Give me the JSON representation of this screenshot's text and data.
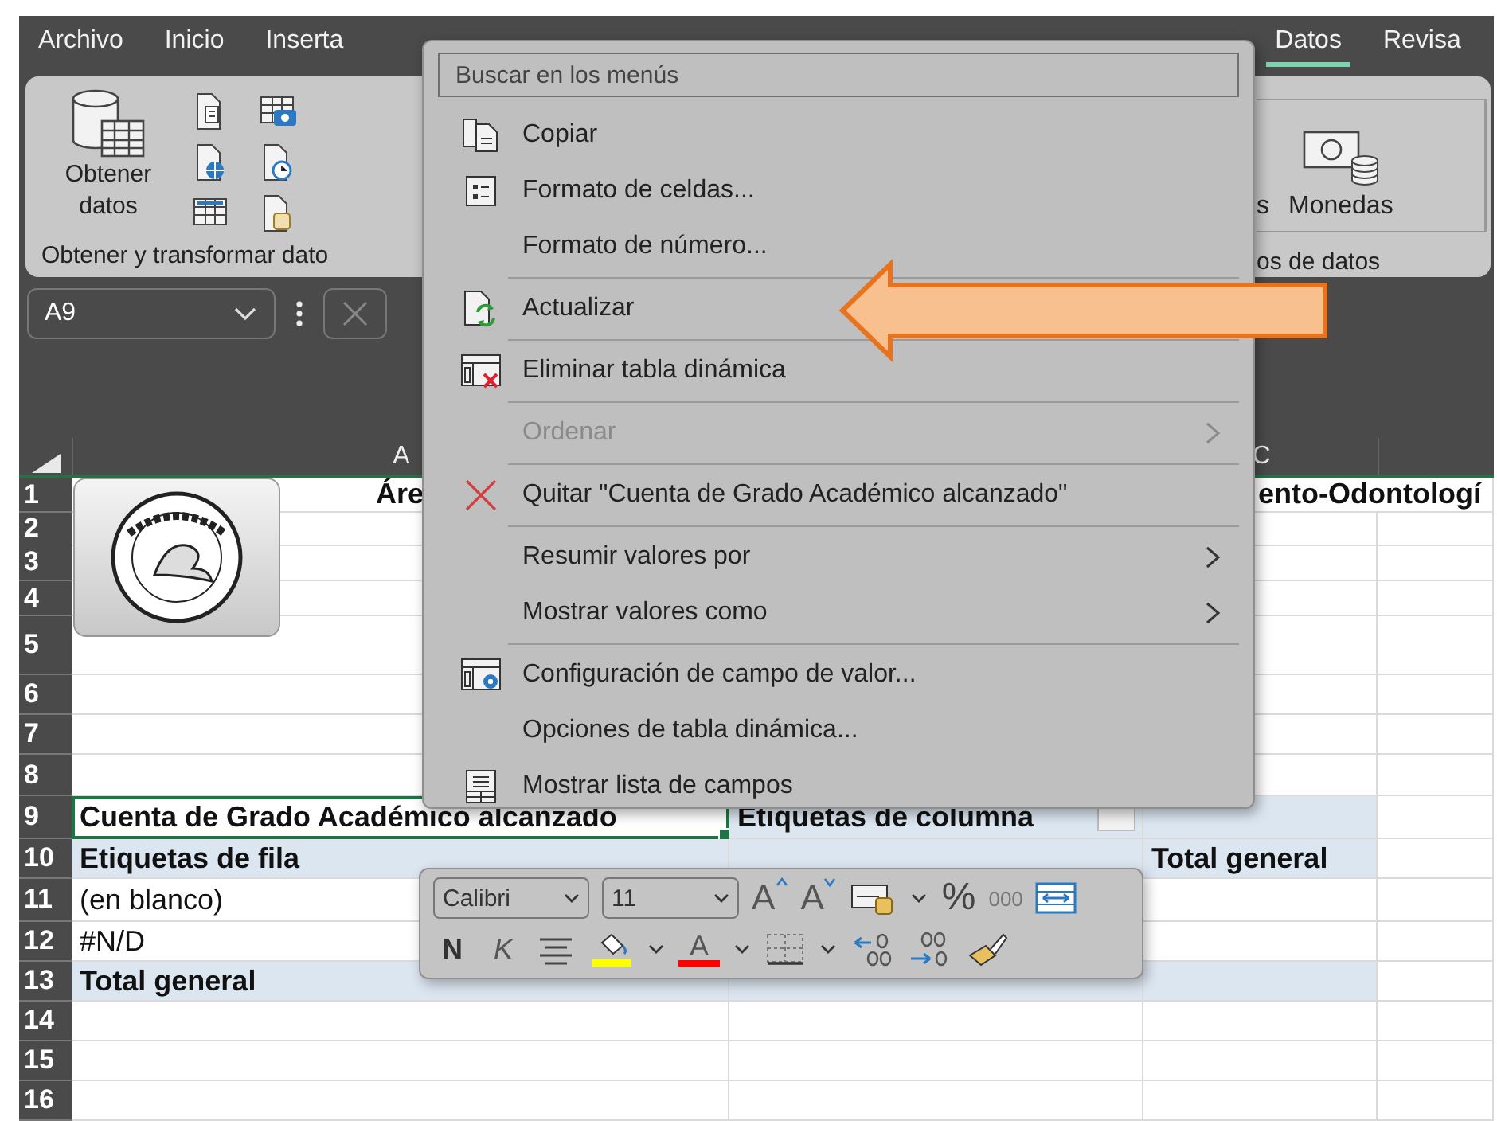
{
  "tabs": [
    {
      "label": "Archivo",
      "selected": false
    },
    {
      "label": "Inicio",
      "selected": false
    },
    {
      "label": "Inserta",
      "selected": false
    },
    {
      "label": "Datos",
      "selected": true
    },
    {
      "label": "Revisa",
      "selected": false
    }
  ],
  "ribbon": {
    "get_data_button": "Obtener datos",
    "left_group_label": "Obtener y transformar dato",
    "partial_button_label": "s",
    "currency_button": "Monedas",
    "right_group_label": "os de datos"
  },
  "formula_bar": {
    "name_box": "A9"
  },
  "sheet": {
    "column_headers": {
      "a": "A",
      "c": "C"
    },
    "rows": [
      {
        "number": "1",
        "kind": "title",
        "cells": {
          "a": {
            "text": "Áre",
            "selected": false
          },
          "c": {
            "text": "ento-Odontologí",
            "selected": false
          }
        }
      },
      {
        "number": "2",
        "kind": "plain",
        "cells": {}
      },
      {
        "number": "3",
        "kind": "plain",
        "cells": {}
      },
      {
        "number": "4",
        "kind": "plain",
        "cells": {}
      },
      {
        "number": "5",
        "kind": "plain",
        "cells": {}
      },
      {
        "number": "6",
        "kind": "plain",
        "cells": {}
      },
      {
        "number": "7",
        "kind": "plain",
        "cells": {}
      },
      {
        "number": "8",
        "kind": "plain",
        "cells": {}
      },
      {
        "number": "9",
        "kind": "band",
        "cells": {
          "a": {
            "text": "Cuenta de Grado Académico alcanzado",
            "selected": true
          },
          "b": {
            "text": "Etiquetas de columna",
            "selected": false
          }
        }
      },
      {
        "number": "10",
        "kind": "band",
        "cells": {
          "a": {
            "text": "Etiquetas de fila",
            "selected": false
          },
          "c": {
            "text": "Total general",
            "selected": false
          }
        }
      },
      {
        "number": "11",
        "kind": "plain",
        "cells": {
          "a": {
            "text": "(en blanco)",
            "selected": false
          }
        }
      },
      {
        "number": "12",
        "kind": "plain",
        "cells": {
          "a": {
            "text": "#N/D",
            "selected": false
          }
        }
      },
      {
        "number": "13",
        "kind": "band",
        "cells": {
          "a": {
            "text": "Total general",
            "selected": false
          }
        }
      },
      {
        "number": "14",
        "kind": "plain",
        "cells": {}
      },
      {
        "number": "15",
        "kind": "plain",
        "cells": {}
      },
      {
        "number": "16",
        "kind": "plain",
        "cells": {}
      }
    ]
  },
  "context_menu": {
    "search_placeholder": "Buscar en los menús",
    "items": [
      {
        "label": "Copiar",
        "kind": "copy",
        "disabled": false,
        "submenu": false,
        "divider_before": false
      },
      {
        "label": "Formato de celdas...",
        "kind": "format",
        "disabled": false,
        "submenu": false,
        "divider_before": false
      },
      {
        "label": "Formato de número...",
        "kind": "plain",
        "disabled": false,
        "submenu": false,
        "divider_before": false
      },
      {
        "label": "Actualizar",
        "kind": "refresh",
        "disabled": false,
        "submenu": false,
        "divider_before": true
      },
      {
        "label": "Eliminar tabla dinámica",
        "kind": "delete",
        "disabled": false,
        "submenu": false,
        "divider_before": true
      },
      {
        "label": "Ordenar",
        "kind": "plain",
        "disabled": true,
        "submenu": true,
        "divider_before": true
      },
      {
        "label": "Quitar \"Cuenta de Grado Académico alcanzado\"",
        "kind": "remove",
        "disabled": false,
        "submenu": false,
        "divider_before": true
      },
      {
        "label": "Resumir valores por",
        "kind": "plain",
        "disabled": false,
        "submenu": true,
        "divider_before": true
      },
      {
        "label": "Mostrar valores como",
        "kind": "plain",
        "disabled": false,
        "submenu": true,
        "divider_before": false
      },
      {
        "label": "Configuración de campo de valor...",
        "kind": "settings",
        "disabled": false,
        "submenu": false,
        "divider_before": true
      },
      {
        "label": "Opciones de tabla dinámica...",
        "kind": "plain",
        "disabled": false,
        "submenu": false,
        "divider_before": false
      },
      {
        "label": "Mostrar lista de campos",
        "kind": "list",
        "disabled": false,
        "submenu": false,
        "divider_before": false
      }
    ]
  },
  "mini_toolbar": {
    "font": "Calibri",
    "size": "11",
    "rows": [
      [
        {
          "kind": "grow-font",
          "glyph": "A"
        },
        {
          "kind": "shrink-font",
          "glyph": "A"
        },
        {
          "kind": "styles"
        },
        {
          "kind": "caret"
        },
        {
          "kind": "percent",
          "glyph": "%"
        },
        {
          "kind": "thousands",
          "glyph": "000"
        },
        {
          "kind": "wrap"
        }
      ],
      [
        {
          "kind": "bold",
          "glyph": "N"
        },
        {
          "kind": "italic",
          "glyph": "K"
        },
        {
          "kind": "align"
        },
        {
          "kind": "fill-color",
          "color": "#ffff00"
        },
        {
          "kind": "caret"
        },
        {
          "kind": "font-color",
          "glyph": "A",
          "color": "#ff0000"
        },
        {
          "kind": "caret"
        },
        {
          "kind": "borders"
        },
        {
          "kind": "caret"
        },
        {
          "kind": "decrease-decimals"
        },
        {
          "kind": "increase-decimals"
        },
        {
          "kind": "format-painter"
        }
      ]
    ]
  }
}
